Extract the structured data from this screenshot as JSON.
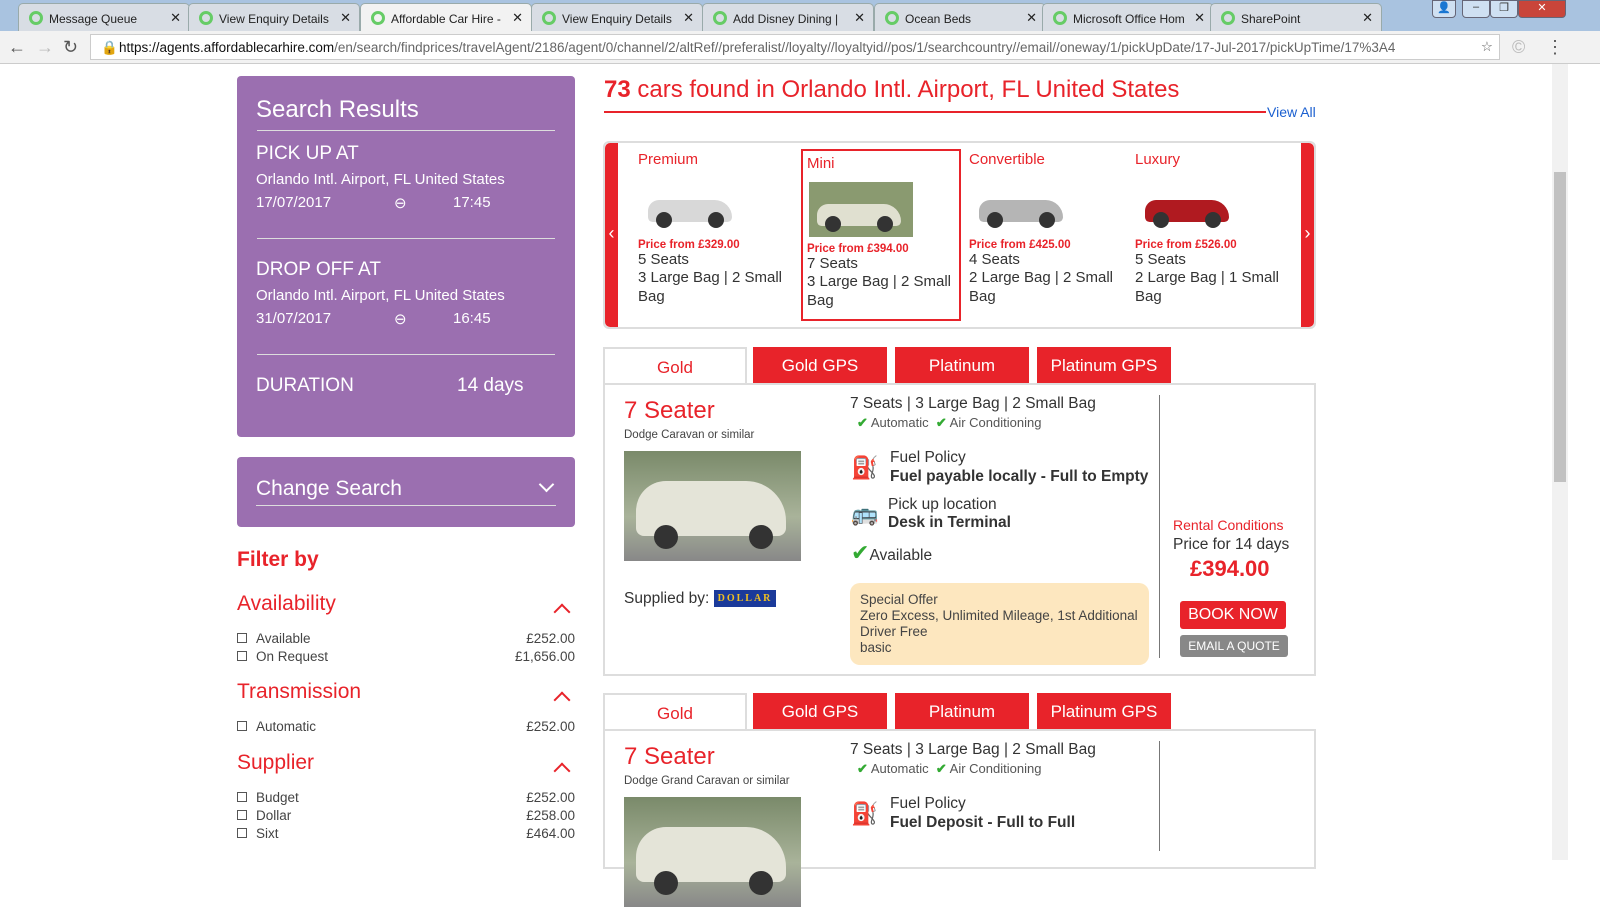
{
  "browser": {
    "tabs": [
      "Message Queue",
      "View Enquiry Details",
      "Affordable Car Hire - ",
      "View Enquiry Details",
      "Add Disney Dining | ",
      "Ocean Beds",
      "Microsoft Office Hom",
      "SharePoint"
    ],
    "url_host": "https://agents.affordablecarhire.com",
    "url_path": "/en/search/findprices/travelAgent/2186/agent/0/channel/2/altRef//preferalist//loyalty//loyaltyid//pos/1/searchcountry//email//oneway/1/pickUpDate/17-Jul-2017/pickUpTime/17%3A4"
  },
  "sidebar": {
    "title": "Search Results",
    "pickup_label": "PICK UP AT",
    "pickup_location": "Orlando Intl. Airport, FL United States",
    "pickup_date": "17/07/2017",
    "pickup_time": "17:45",
    "dropoff_label": "DROP OFF AT",
    "dropoff_location": "Orlando Intl. Airport, FL United States",
    "dropoff_date": "31/07/2017",
    "dropoff_time": "16:45",
    "duration_label": "DURATION",
    "duration_value": "14 days",
    "change_search": "Change Search",
    "filter_title": "Filter by",
    "filters": [
      {
        "title": "Availability",
        "items": [
          {
            "label": "Available",
            "price": "£252.00"
          },
          {
            "label": "On Request",
            "price": "£1,656.00"
          }
        ]
      },
      {
        "title": "Transmission",
        "items": [
          {
            "label": "Automatic",
            "price": "£252.00"
          }
        ]
      },
      {
        "title": "Supplier",
        "items": [
          {
            "label": "Budget",
            "price": "£252.00"
          },
          {
            "label": "Dollar",
            "price": "£258.00"
          },
          {
            "label": "Sixt",
            "price": "£464.00"
          }
        ]
      }
    ]
  },
  "main": {
    "heading_count": "73",
    "heading_text": " cars found in Orlando Intl. Airport, FL United States",
    "view_all": "View All",
    "categories": [
      {
        "name": "Premium",
        "price": "Price from £329.00",
        "seats": "5 Seats",
        "bags": "3 Large Bag | 2 Small Bag",
        "color": "#d8d8d8"
      },
      {
        "name": "Mini",
        "price": "Price from £394.00",
        "seats": "7 Seats",
        "bags": "3 Large Bag | 2 Small Bag",
        "color": "#e0e0d0"
      },
      {
        "name": "Convertible",
        "price": "Price from £425.00",
        "seats": "4 Seats",
        "bags": "2 Large Bag | 2 Small Bag",
        "color": "#b5b5b5"
      },
      {
        "name": "Luxury",
        "price": "Price from £526.00",
        "seats": "5 Seats",
        "bags": "2 Large Bag | 1 Small Bag",
        "color": "#b01a20"
      }
    ],
    "tabs": [
      "Gold",
      "Gold GPS",
      "Platinum",
      "Platinum GPS"
    ],
    "results": [
      {
        "title": "7 Seater",
        "model": "Dodge Caravan or similar",
        "specs": "7 Seats | 3 Large Bag | 2 Small Bag",
        "feat1": "Automatic",
        "feat2": "Air Conditioning",
        "fuel_label": "Fuel Policy",
        "fuel_value": "Fuel payable locally - Full to Empty",
        "pickup_label": "Pick up location",
        "pickup_value": "Desk in Terminal",
        "availability": "Available",
        "supplied_by": "Supplied by:",
        "supplier_logo": "DOLLAR",
        "offer_title": "Special Offer",
        "offer_text": "Zero Excess, Unlimited Mileage, 1st Additional Driver Free",
        "offer_extra": "basic",
        "rental_conditions": "Rental Conditions",
        "price_label": "Price for 14 days",
        "price": "£394.00",
        "book": "BOOK NOW",
        "email": "EMAIL A QUOTE"
      },
      {
        "title": "7 Seater",
        "model": "Dodge Grand Caravan or similar",
        "specs": "7 Seats | 3 Large Bag | 2 Small Bag",
        "feat1": "Automatic",
        "feat2": "Air Conditioning",
        "fuel_label": "Fuel Policy",
        "fuel_value": "Fuel Deposit - Full to Full"
      }
    ]
  }
}
